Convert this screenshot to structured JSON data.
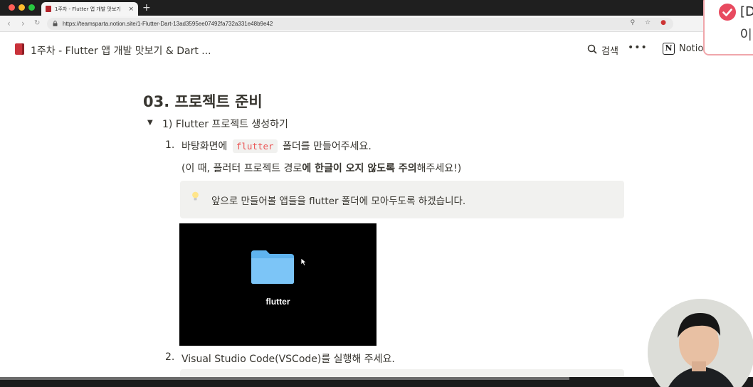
{
  "browser": {
    "tab_title": "1주차 - Flutter 앱 개발 맛보기",
    "url": "https://teamsparta.notion.site/1-Flutter-Dart-13ad3595ee07492fa732a331e48b9e42",
    "new_tab": "+",
    "tab_close": "×"
  },
  "notion": {
    "page_title": "1주차 - Flutter 앱 개발 맛보기 & Dart ...",
    "search_label": "검색",
    "more": "•••",
    "logo_letter": "N",
    "logo_label": "Notion"
  },
  "content": {
    "heading": "03. 프로젝트 준비",
    "toggle_arrow": "▼",
    "toggle_title": "1) Flutter 프로젝트 생성하기",
    "step1_number": "1.",
    "step1_before": "바탕화면에",
    "step1_code": "flutter",
    "step1_after": "폴더를 만들어주세요.",
    "step1_note_prefix": "(이 때, 플러터 프로젝트 경로",
    "step1_note_bold": "에 한글이 오지 않도록 주의",
    "step1_note_suffix": "해주세요!)",
    "callout_text": "앞으로 만들어볼 앱들을 flutter 폴더에 모아두도록 하겠습니다.",
    "image_label": "flutter",
    "step2_number": "2.",
    "step2_text": "Visual Studio Code(VSCode)를 실행해 주세요."
  },
  "toast": {
    "title": "[D",
    "subtitle": "0|"
  },
  "colors": {
    "tab_close": "#444444",
    "code_text": "#eb5757",
    "callout_bg": "#f1f1ef",
    "notion_text": "#37352f",
    "toast_accent": "#e84a5f"
  }
}
